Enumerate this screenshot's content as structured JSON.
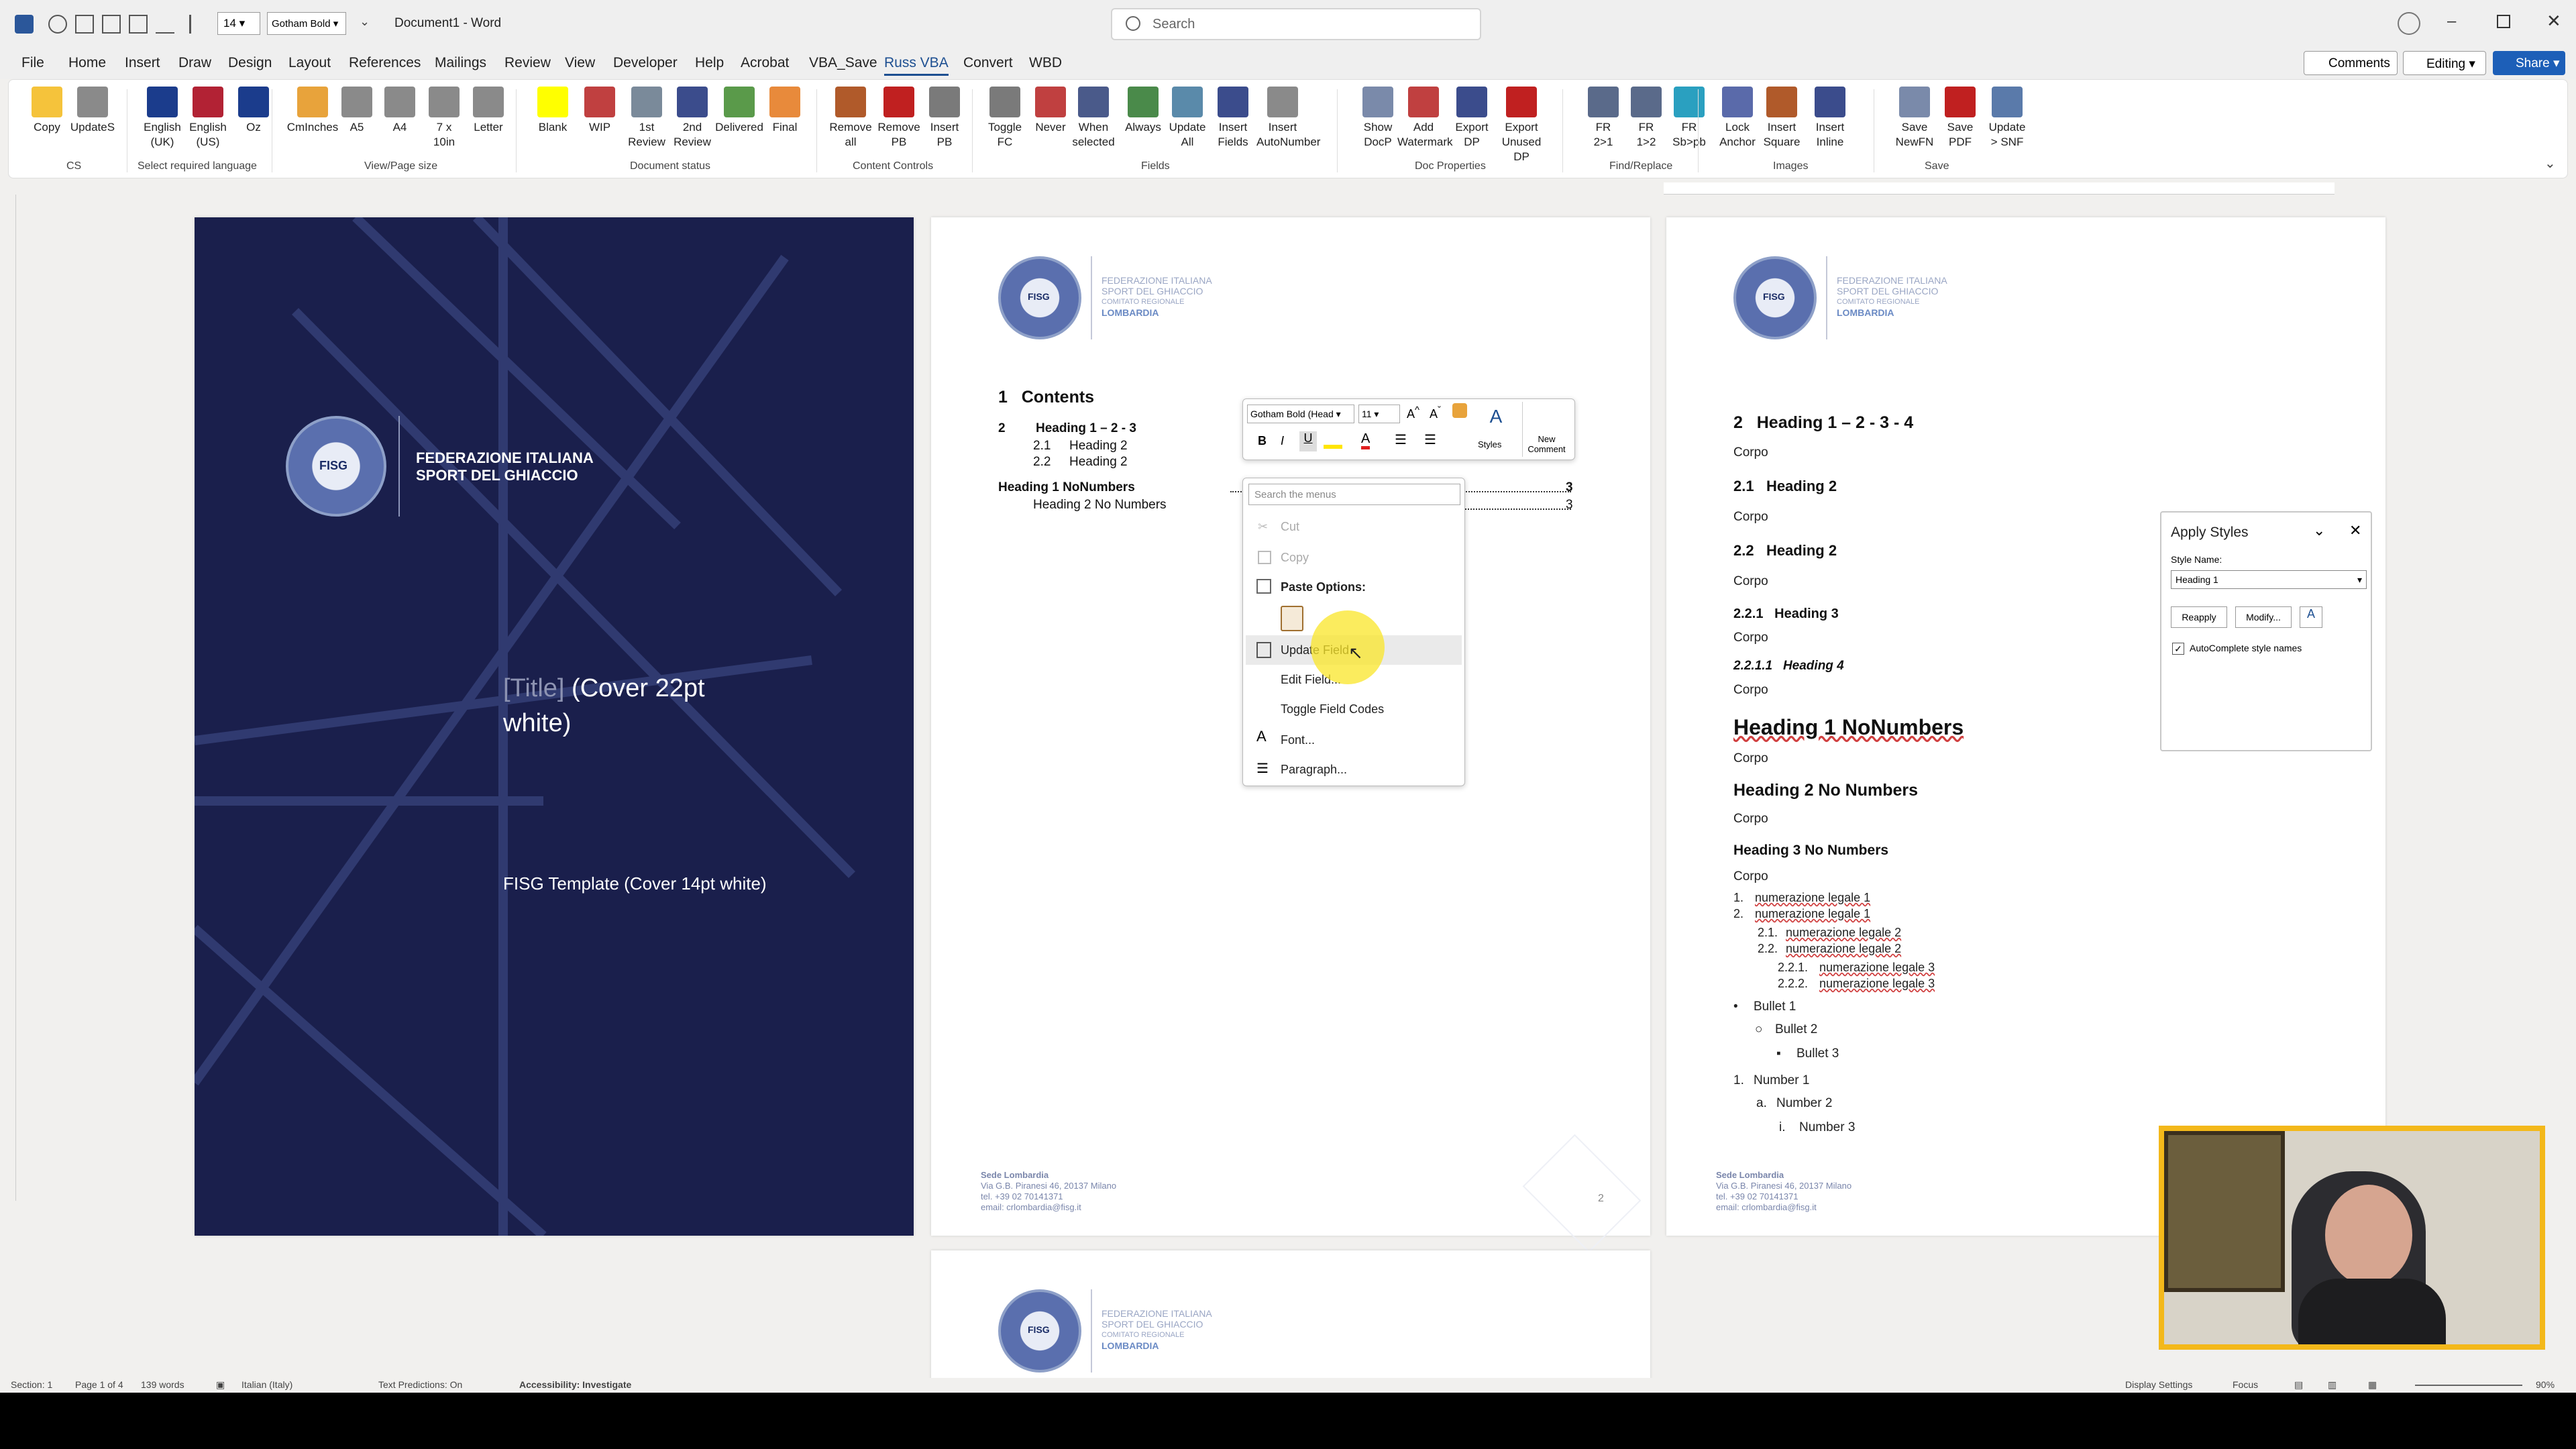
{
  "app": {
    "doc_title": "Document1 - Word",
    "font_size": "14",
    "font_name": "Gotham Bold"
  },
  "search": {
    "placeholder": "Search"
  },
  "menubar": {
    "items": [
      "File",
      "Home",
      "Insert",
      "Draw",
      "Design",
      "Layout",
      "References",
      "Mailings",
      "Review",
      "View",
      "Developer",
      "Help",
      "Acrobat",
      "VBA_Save",
      "Russ VBA",
      "Convert",
      "WBD"
    ],
    "active": "Russ VBA",
    "comments": "Comments",
    "editing": "Editing",
    "share": "Share"
  },
  "ribbon": {
    "buttons": [
      {
        "label": "Copy",
        "color": "#f5c33b"
      },
      {
        "label": "UpdateS",
        "color": "#8a8a8a"
      },
      {
        "label": "English\n(UK)",
        "color": "#1b3c8c"
      },
      {
        "label": "English\n(US)",
        "color": "#b22234"
      },
      {
        "label": "Oz",
        "color": "#1b3c8c"
      },
      {
        "label": "CmInches",
        "color": "#e8a33b"
      },
      {
        "label": "A5",
        "color": "#8a8a8a"
      },
      {
        "label": "A4",
        "color": "#8a8a8a"
      },
      {
        "label": "7 x\n10in",
        "color": "#8a8a8a"
      },
      {
        "label": "Letter",
        "color": "#8a8a8a"
      },
      {
        "label": "Blank",
        "color": "#ffff00"
      },
      {
        "label": "WIP",
        "color": "#c04040"
      },
      {
        "label": "1st\nReview",
        "color": "#7a8a9a"
      },
      {
        "label": "2nd\nReview",
        "color": "#3b4c8c"
      },
      {
        "label": "Delivered",
        "color": "#5a9a4a"
      },
      {
        "label": "Final",
        "color": "#e88a3b"
      },
      {
        "label": "Remove\nall",
        "color": "#b05a2a"
      },
      {
        "label": "Remove\nPB",
        "color": "#c02020"
      },
      {
        "label": "Insert\nPB",
        "color": "#7a7a7a"
      },
      {
        "label": "Toggle\nFC",
        "color": "#7a7a7a"
      },
      {
        "label": "Never",
        "color": "#c04040"
      },
      {
        "label": "When\nselected",
        "color": "#4a5a8a"
      },
      {
        "label": "Always",
        "color": "#4a8a4a"
      },
      {
        "label": "Update\nAll",
        "color": "#5a8aaa"
      },
      {
        "label": "Insert\nFields",
        "color": "#3b4c8c"
      },
      {
        "label": "Insert\nAutoNumber",
        "color": "#8a8a8a"
      },
      {
        "label": "Show\nDocP",
        "color": "#7a8aaa"
      },
      {
        "label": "Add\nWatermark",
        "color": "#c04040"
      },
      {
        "label": "Export\nDP",
        "color": "#3b4c8c"
      },
      {
        "label": "Export\nUnused DP",
        "color": "#c02020"
      },
      {
        "label": "FR\n2>1",
        "color": "#5a6a8a"
      },
      {
        "label": "FR\n1>2",
        "color": "#5a6a8a"
      },
      {
        "label": "FR\nSb>pb",
        "color": "#2aa0c0"
      },
      {
        "label": "Lock\nAnchor",
        "color": "#5a6aaa"
      },
      {
        "label": "Insert\nSquare",
        "color": "#b05a2a"
      },
      {
        "label": "Insert\nInline",
        "color": "#3b4c8c"
      },
      {
        "label": "Save\nNewFN",
        "color": "#7a8aaa"
      },
      {
        "label": "Save\nPDF",
        "color": "#c02020"
      },
      {
        "label": "Update\n> SNF",
        "color": "#5a7aaa"
      }
    ],
    "groups": [
      "CS",
      "Select required language",
      "View/Page size",
      "Document status",
      "Content Controls",
      "Fields",
      "Doc Properties",
      "Find/Replace",
      "Images",
      "Save"
    ]
  },
  "cover": {
    "org_line1": "FEDERAZIONE ITALIANA",
    "org_line2": "SPORT DEL GHIACCIO",
    "title_placeholder": "[Title]",
    "title_rest": " (Cover 22pt",
    "title_line2": "white)",
    "subtitle": "FISG Template (Cover 14pt white)",
    "logo_text": "FISG"
  },
  "letterhead": {
    "line1": "FEDERAZIONE ITALIANA",
    "line2": "SPORT DEL GHIACCIO",
    "line3": "COMITATO REGIONALE",
    "line4": "LOMBARDIA",
    "logo_text": "FISG"
  },
  "footer": {
    "sede": "Sede Lombardia",
    "address": "Via G.B. Piranesi 46, 20137 Milano",
    "tel": "tel. +39 02 70141371",
    "email": "email: crlombardia@fisg.it",
    "page_num": "2"
  },
  "toc": {
    "heading_num": "1",
    "heading": "Contents",
    "rows": [
      {
        "num": "2",
        "text": "Heading 1 – 2 - 3",
        "page": ""
      },
      {
        "num": "2.1",
        "text": "Heading 2",
        "page": ""
      },
      {
        "num": "2.2",
        "text": "Heading 2",
        "page": ""
      },
      {
        "num": "",
        "text": "Heading 1 NoNumbers",
        "page": "3"
      },
      {
        "num": "",
        "text": "Heading 2 No Numbers",
        "page": "3"
      }
    ]
  },
  "mini_toolbar": {
    "font": "Gotham Bold (Head",
    "size": "11",
    "styles": "Styles",
    "new_comment": "New\nComment"
  },
  "context_menu": {
    "search": "Search the menus",
    "cut": "Cut",
    "copy": "Copy",
    "paste_options": "Paste Options:",
    "update_field": "Update Field",
    "edit_field": "Edit Field...",
    "toggle": "Toggle Field Codes",
    "font": "Font...",
    "paragraph": "Paragraph..."
  },
  "page3": {
    "h1": "Heading 1 – 2 - 3 - 4",
    "h1_num": "2",
    "corpo": "Corpo",
    "h2a_num": "2.1",
    "h2a": "Heading 2",
    "h2b_num": "2.2",
    "h2b": "Heading 2",
    "h3_num": "2.2.1",
    "h3": "Heading 3",
    "h4_num": "2.2.1.1",
    "h4": "Heading 4",
    "h1nn": "Heading 1 NoNumbers",
    "h2nn": "Heading 2 No Numbers",
    "h3nn": "Heading 3 No Numbers",
    "legal": [
      {
        "n": "1.",
        "t": "numerazione legale 1"
      },
      {
        "n": "2.",
        "t": "numerazione legale 1"
      },
      {
        "n": "2.1.",
        "t": "numerazione legale 2"
      },
      {
        "n": "2.2.",
        "t": "numerazione legale 2"
      },
      {
        "n": "2.2.1.",
        "t": "numerazione legale 3"
      },
      {
        "n": "2.2.2.",
        "t": "numerazione legale 3"
      }
    ],
    "bullets": [
      "Bullet 1",
      "Bullet 2",
      "Bullet 3"
    ],
    "numbers": [
      {
        "n": "1.",
        "t": "Number 1"
      },
      {
        "n": "a.",
        "t": "Number 2"
      },
      {
        "n": "i.",
        "t": "Number 3"
      }
    ]
  },
  "apply_styles": {
    "title": "Apply Styles",
    "style_name_label": "Style Name:",
    "style_value": "Heading 1",
    "reapply": "Reapply",
    "modify": "Modify...",
    "autocomplete": "AutoComplete style names"
  },
  "statusbar": {
    "section": "Section: 1",
    "page": "Page 1 of 4",
    "words": "139 words",
    "language": "Italian (Italy)",
    "predictions": "Text Predictions: On",
    "accessibility": "Accessibility: Investigate",
    "display": "Display Settings",
    "focus": "Focus",
    "zoom": "90%"
  }
}
